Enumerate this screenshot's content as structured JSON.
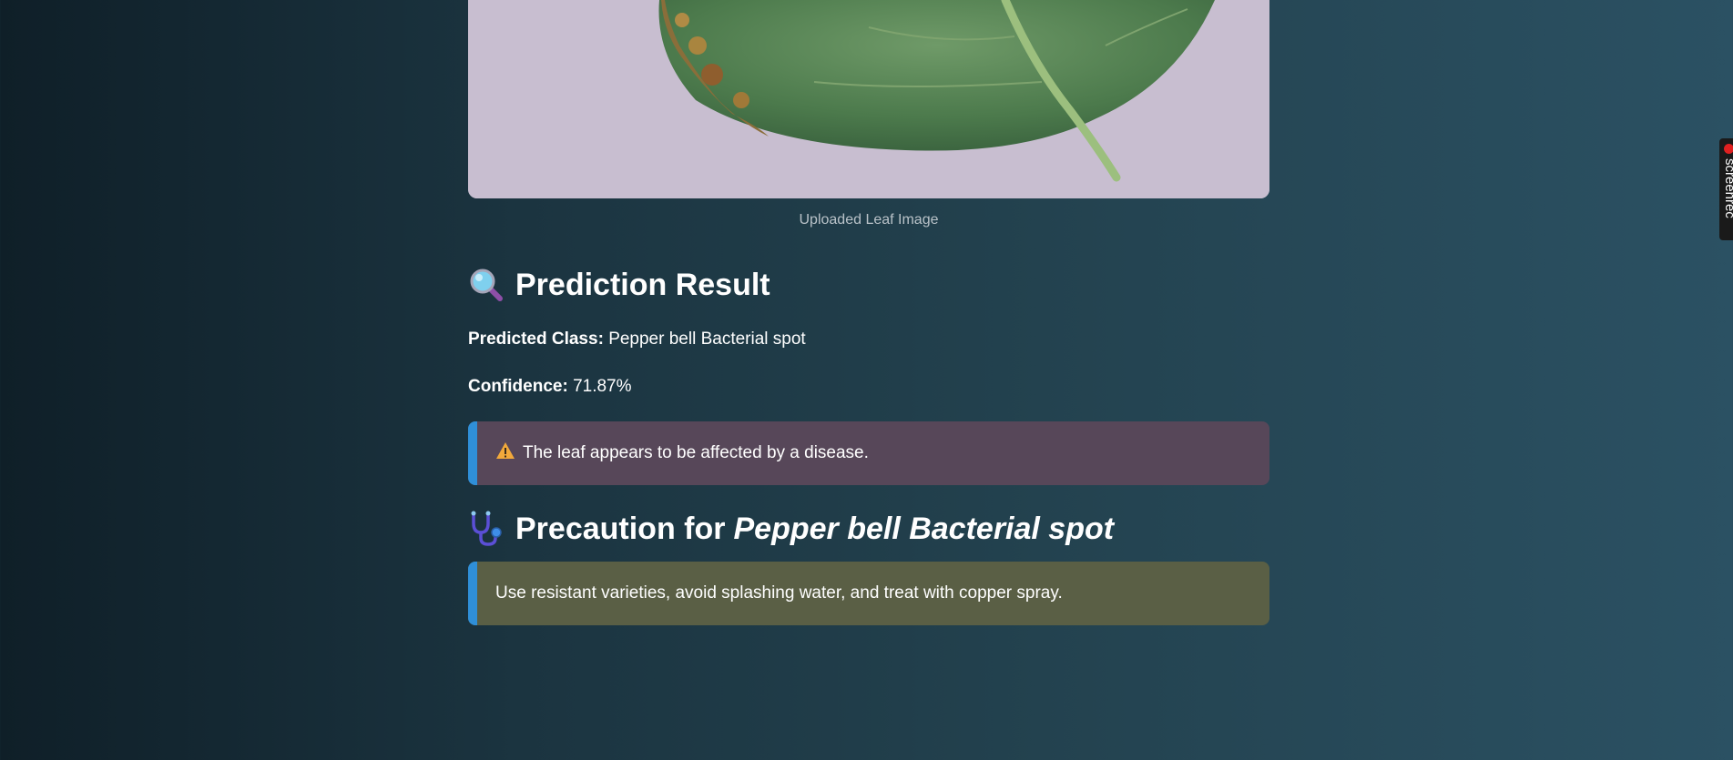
{
  "image": {
    "caption": "Uploaded Leaf Image"
  },
  "prediction": {
    "heading": "Prediction Result",
    "heading_icon": "magnifying-glass-icon",
    "class_label": "Predicted Class:",
    "class_value": "Pepper bell Bacterial spot",
    "confidence_label": "Confidence:",
    "confidence_value": "71.87%"
  },
  "warning": {
    "icon": "warning-icon",
    "text": "The leaf appears to be affected by a disease."
  },
  "precaution": {
    "heading_prefix": "Precaution for",
    "heading_disease": "Pepper bell Bacterial spot",
    "heading_icon": "stethoscope-icon",
    "text": "Use resistant varieties, avoid splashing water, and treat with copper spray."
  },
  "screen_recorder": {
    "label": "screenrec"
  },
  "colors": {
    "accent_bar": "#2f8fd8",
    "warning_bg": "#574759",
    "info_bg": "#5a5f45"
  }
}
